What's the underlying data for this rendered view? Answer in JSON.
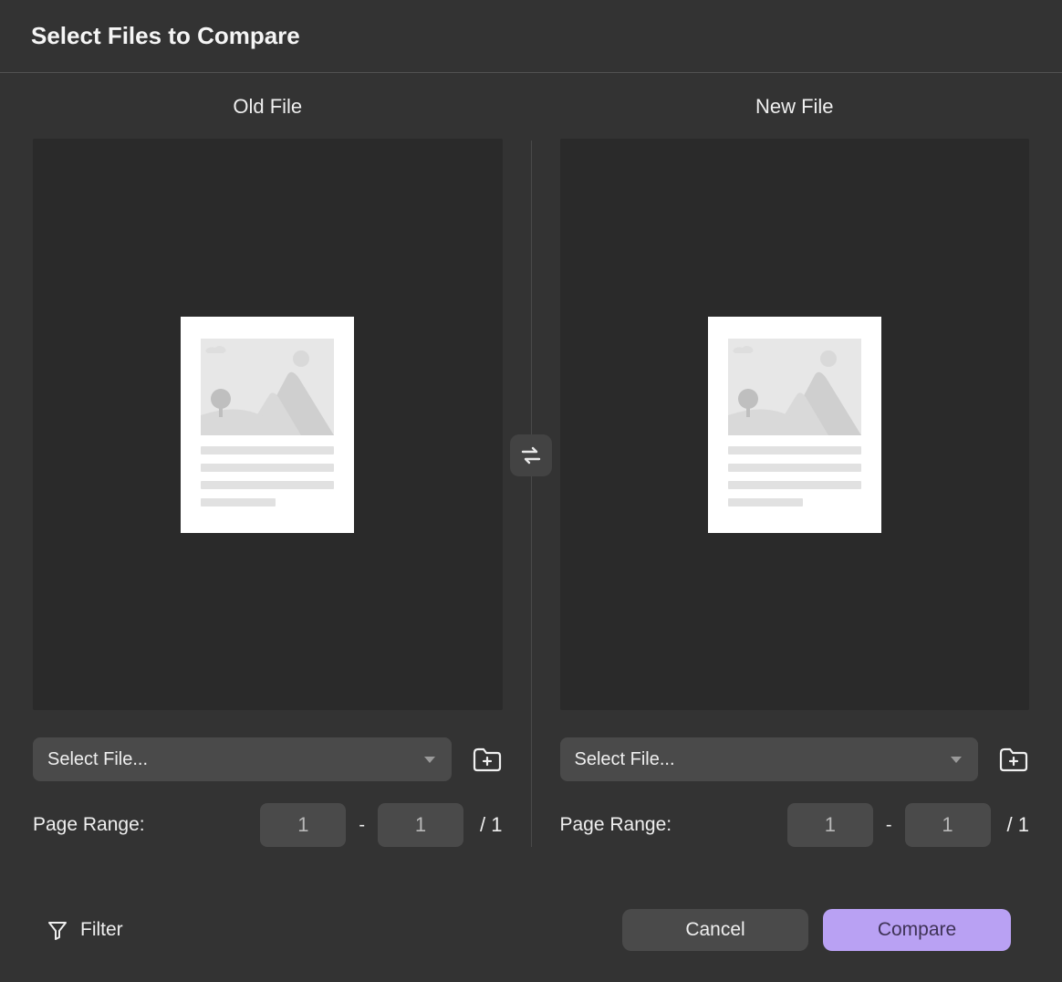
{
  "header": {
    "title": "Select Files to Compare"
  },
  "swap_icon": "swap-horizontal",
  "old_panel": {
    "title": "Old File",
    "select_placeholder": "Select File...",
    "folder_icon": "folder-open",
    "range_label": "Page Range:",
    "from": "1",
    "to": "1",
    "total": "1"
  },
  "new_panel": {
    "title": "New File",
    "select_placeholder": "Select File...",
    "folder_icon": "folder-open",
    "range_label": "Page Range:",
    "from": "1",
    "to": "1",
    "total": "1"
  },
  "footer": {
    "filter_label": "Filter",
    "cancel_label": "Cancel",
    "compare_label": "Compare"
  }
}
